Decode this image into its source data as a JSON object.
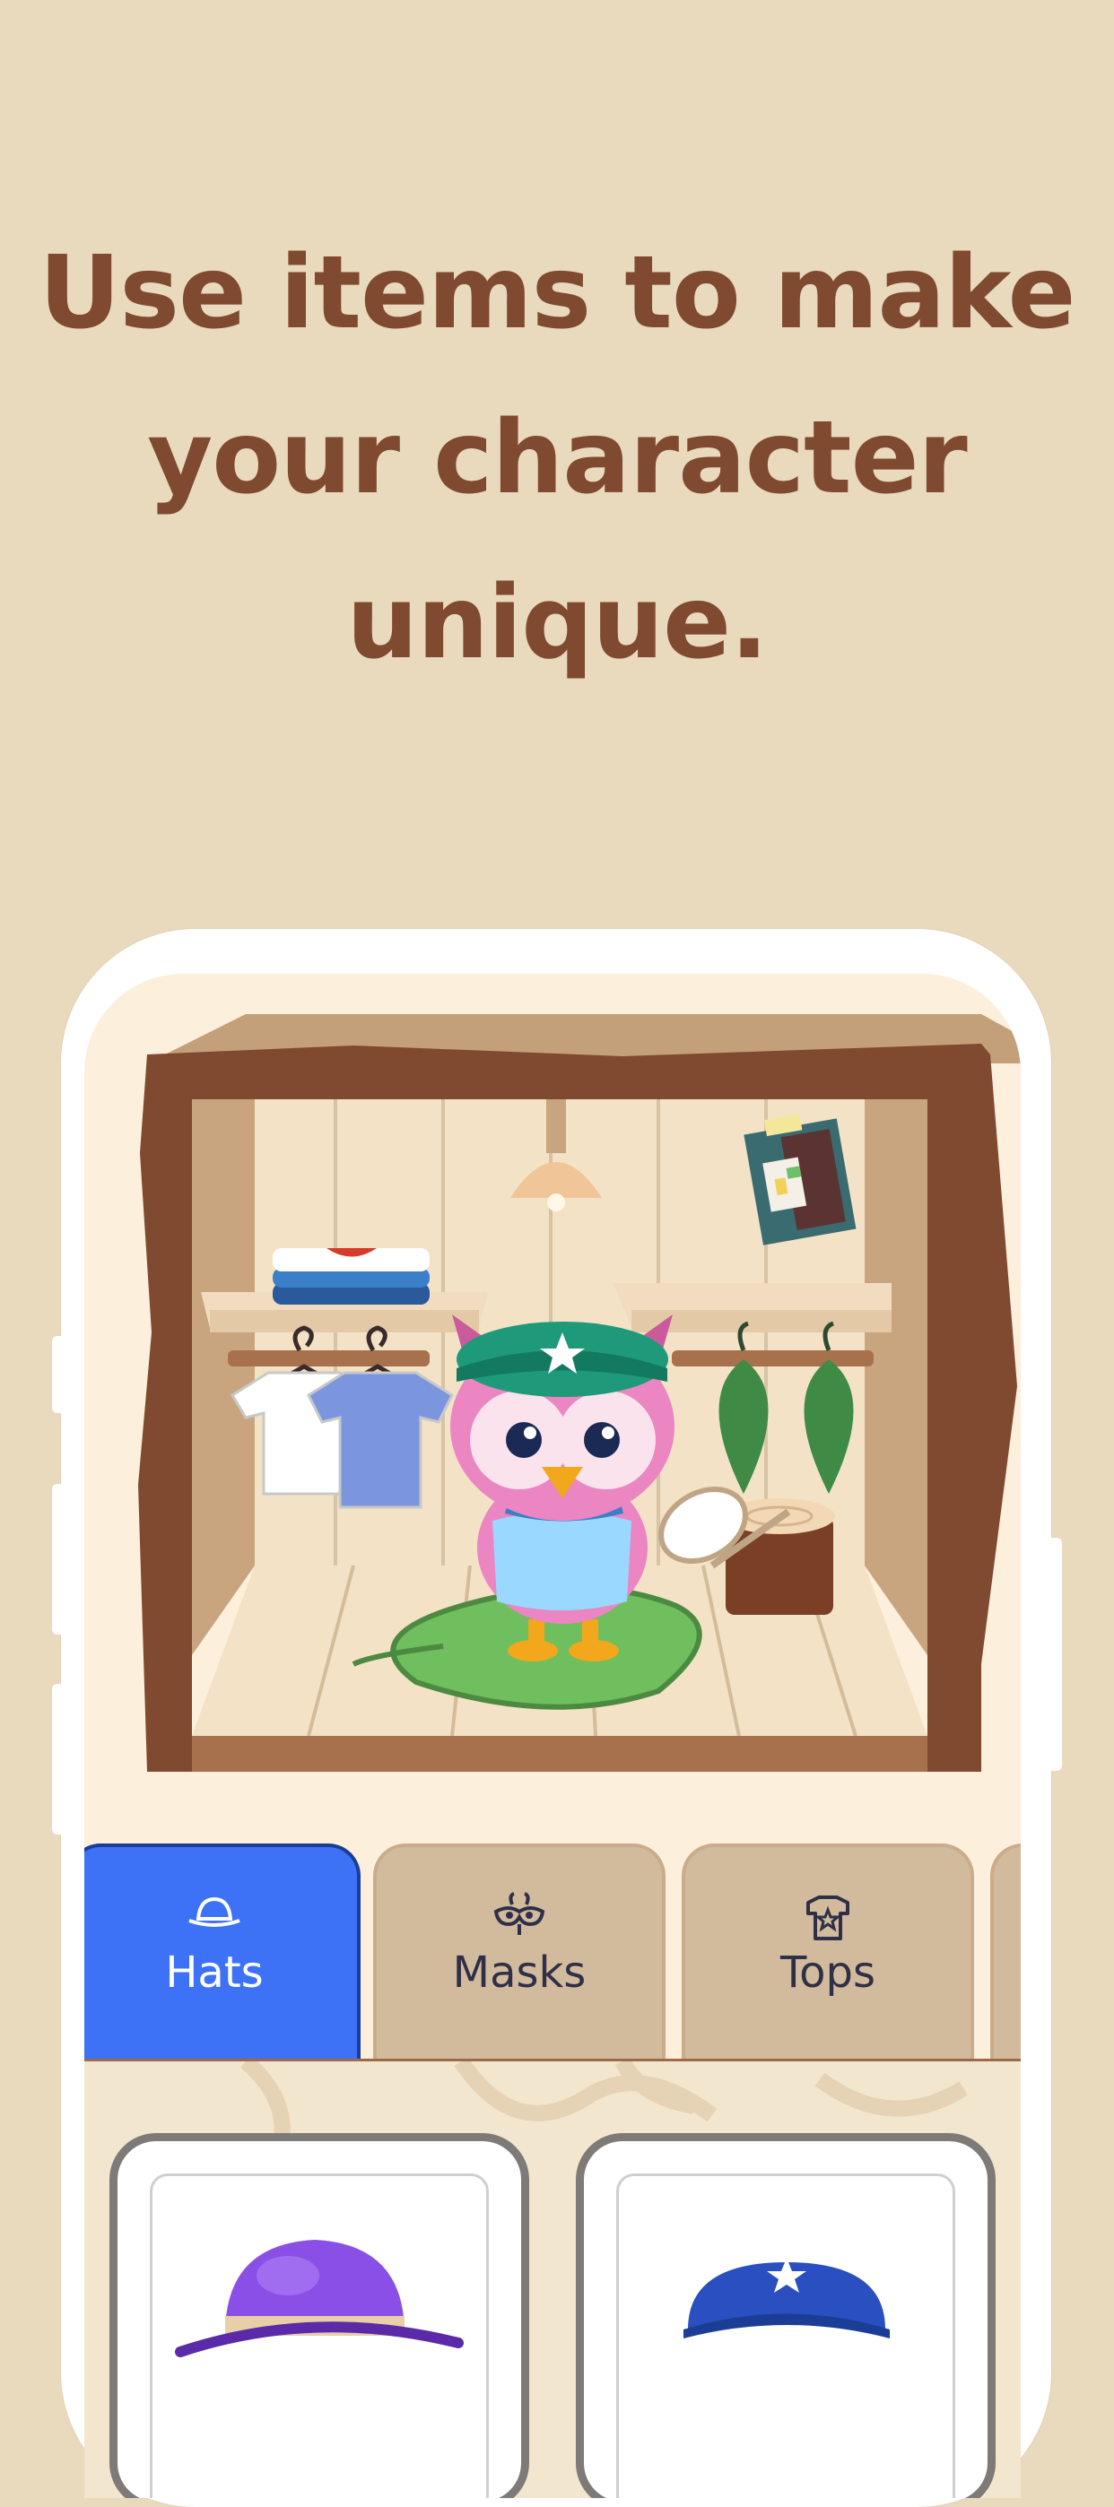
{
  "headline": {
    "line1": "Use items to make",
    "line2": "your character",
    "line3": "unique."
  },
  "tabs": [
    {
      "label": "Hats",
      "icon": "hat-icon",
      "active": true
    },
    {
      "label": "Masks",
      "icon": "mask-icon",
      "active": false
    },
    {
      "label": "Tops",
      "icon": "shirt-icon",
      "active": false
    }
  ],
  "items": [
    {
      "icon": "purple-bucket-hat-icon"
    },
    {
      "icon": "blue-cap-icon"
    }
  ],
  "colors": {
    "background": "#e9d9bd",
    "headline": "#7f4a30",
    "active_tab": "#3d72f6",
    "inactive_tab": "#d2bb9c"
  }
}
